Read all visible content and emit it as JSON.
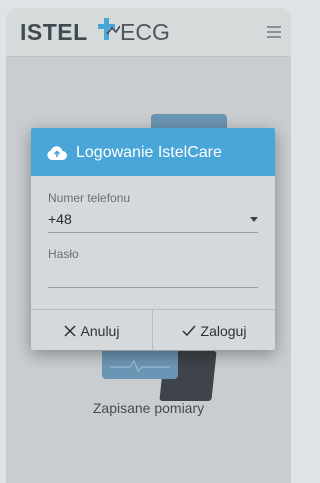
{
  "header": {
    "logo_bold": "ISTEL",
    "logo_light": "ECG",
    "menu_icon": "hamburger-menu-icon"
  },
  "background": {
    "caption": "Zapisane pomiary"
  },
  "dialog": {
    "title": "Logowanie IstelCare",
    "title_icon": "cloud-upload-icon",
    "phone_label": "Numer telefonu",
    "phone_value": "+48",
    "password_label": "Hasło",
    "password_value": "",
    "cancel_label": "Anuluj",
    "login_label": "Zaloguj"
  },
  "colors": {
    "accent": "#4aa6d9",
    "appbar": "#d7dadb"
  }
}
